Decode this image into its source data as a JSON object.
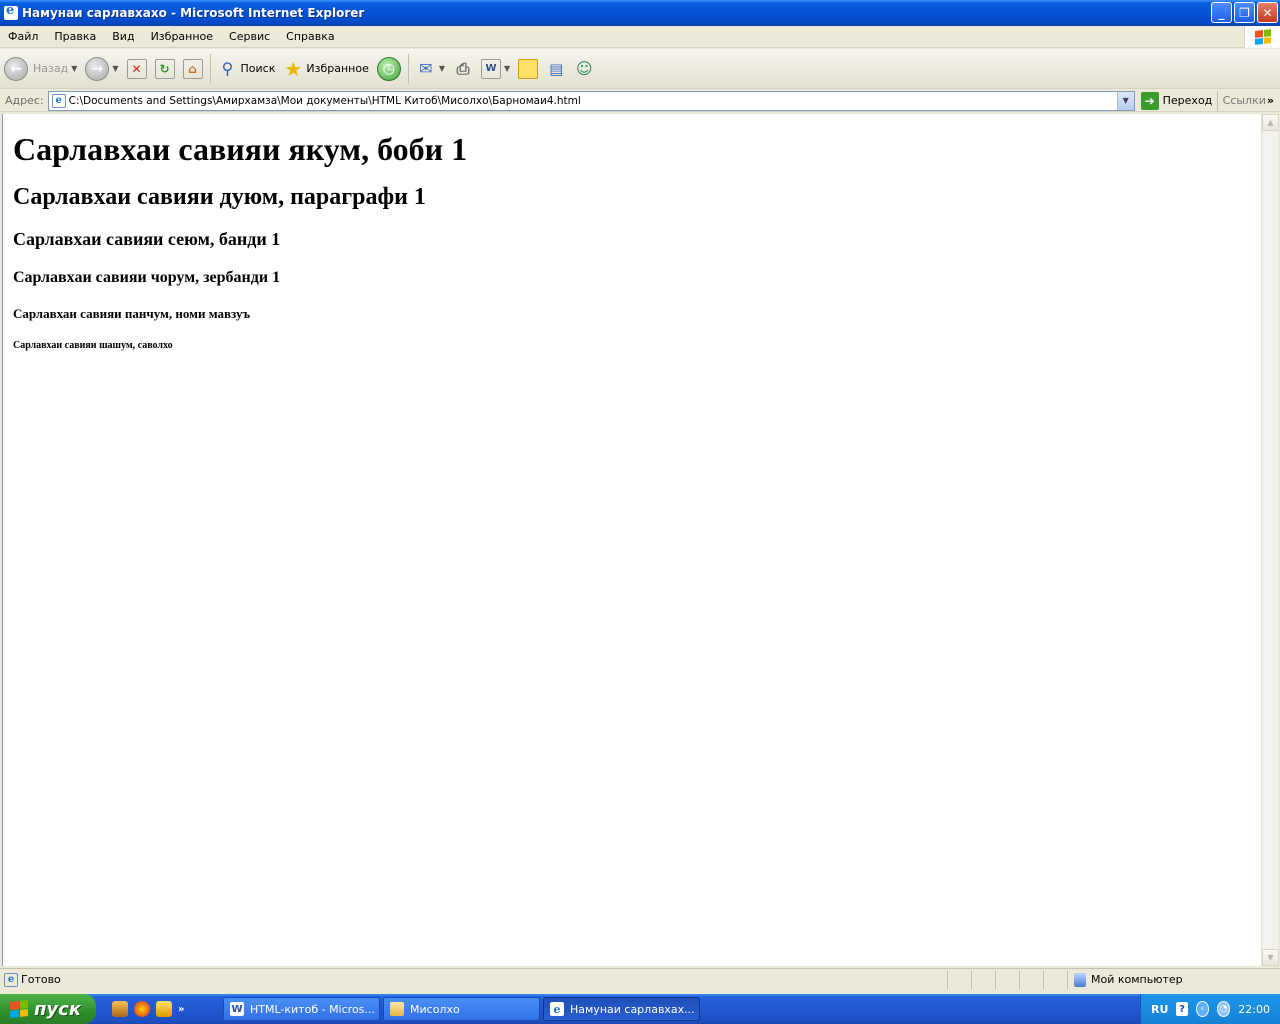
{
  "window": {
    "title": "Намунаи сарлавхахо - Microsoft Internet Explorer",
    "controls": {
      "minimize": "_",
      "maximize": "❐",
      "close": "✕"
    }
  },
  "menu": [
    "Файл",
    "Правка",
    "Вид",
    "Избранное",
    "Сервис",
    "Справка"
  ],
  "toolbar": {
    "back_label": "Назад",
    "search_label": "Поиск",
    "favorites_label": "Избранное"
  },
  "address_bar": {
    "label": "Адрес:",
    "value": "C:\\Documents and Settings\\Амирхамза\\Мои документы\\HTML Китоб\\Мисолхо\\Барномаи4.html",
    "go_label": "Переход",
    "links_label": "Ссылки"
  },
  "page": {
    "h1": "Сарлавхаи савияи якум, боби 1",
    "h2": "Сарлавхаи савияи дуюм, параграфи 1",
    "h3": "Сарлавхаи савияи сеюм, банди 1",
    "h4": "Сарлавхаи савияи чорум, зербанди 1",
    "h5": "Сарлавхаи савияи панчум, номи мавзуъ",
    "h6": "Сарлавхаи савияи шашум, саволхо"
  },
  "status_bar": {
    "status": "Готово",
    "zone": "Мой компьютер"
  },
  "taskbar": {
    "start_label": "пуск",
    "tasks": [
      {
        "label": "HTML-китоб - Micros...",
        "icon": "word-icon",
        "active": false
      },
      {
        "label": "Мисолхо",
        "icon": "folder-icon",
        "active": false
      },
      {
        "label": "Намунаи сарлавхах...",
        "icon": "ie-icon",
        "active": true
      }
    ],
    "language": "RU",
    "clock": "22:00"
  }
}
